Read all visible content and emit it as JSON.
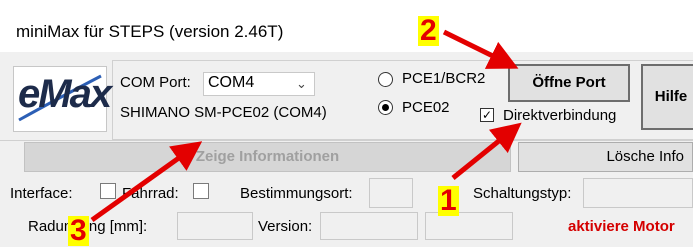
{
  "window": {
    "title": "miniMax für STEPS (version 2.46T)"
  },
  "logo": {
    "text": "eMax"
  },
  "com": {
    "label": "COM Port:",
    "selected": "COM4",
    "device": "SHIMANO SM-PCE02 (COM4)"
  },
  "mode": {
    "option1": "PCE1/BCR2",
    "option2": "PCE02",
    "selected": "PCE02",
    "direct_label": "Direktverbindung",
    "direct_checked": true
  },
  "buttons": {
    "open_port": "Öffne Port",
    "help": "Hilfe",
    "show_info": "Zeige Informationen",
    "clear_info": "Lösche Info"
  },
  "info": {
    "interface_label": "Interface:",
    "bike_label": "Fahrrad:",
    "destination_label": "Bestimmungsort:",
    "shift_type_label": "Schaltungstyp:",
    "wheel_label": "Radumfang [mm]:",
    "version_label": "Version:",
    "activate_motor": "aktiviere Motor"
  },
  "annotations": {
    "marker1": "1",
    "marker2": "2",
    "marker3": "3",
    "color": "#e30000",
    "highlight": "#ffff00"
  }
}
